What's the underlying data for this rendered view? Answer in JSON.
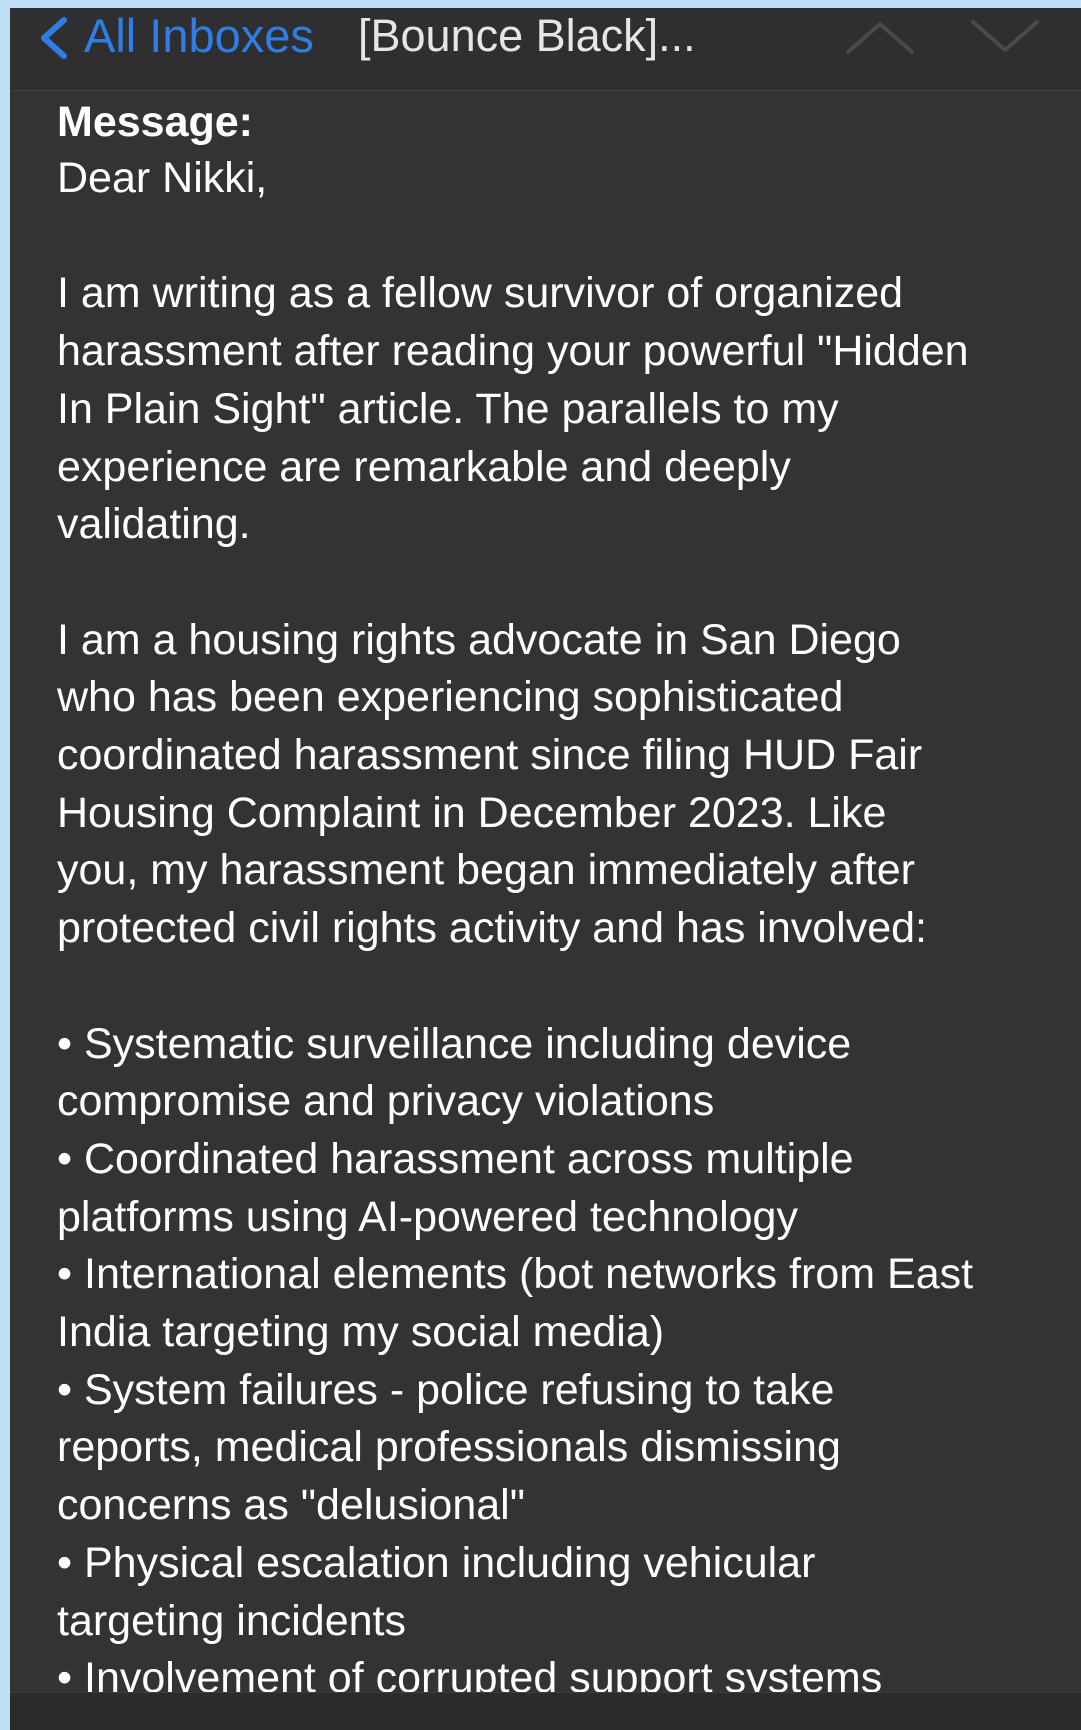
{
  "nav": {
    "back_label": "All Inboxes",
    "title": "[Bounce Black]...",
    "back_icon": "chevron-left-icon",
    "prev_icon": "chevron-up-icon",
    "next_icon": "chevron-down-icon",
    "accent_color": "#2f7ee6"
  },
  "message": {
    "label": "Message:",
    "greeting": "Dear Nikki,",
    "paragraph_1": "I am writing as a fellow survivor of organized\nharassment after reading your powerful \"Hidden\nIn Plain Sight\" article. The parallels to my\nexperience are remarkable and deeply\nvalidating.",
    "paragraph_2": "I am a housing rights advocate in San Diego\nwho has been experiencing sophisticated\ncoordinated harassment since filing HUD Fair\nHousing Complaint in December 2023. Like\nyou, my harassment began immediately after\nprotected civil rights activity and has involved:",
    "bullets": [
      "• Systematic surveillance including device\ncompromise and privacy violations",
      "• Coordinated harassment across multiple\nplatforms using AI-powered technology",
      "• International elements (bot networks from East\nIndia targeting my social media)",
      "• System failures - police refusing to take\nreports, medical professionals dismissing\nconcerns as \"delusional\"",
      "• Physical escalation including vehicular\ntargeting incidents",
      "• Involvement of corrupted support systems"
    ]
  }
}
